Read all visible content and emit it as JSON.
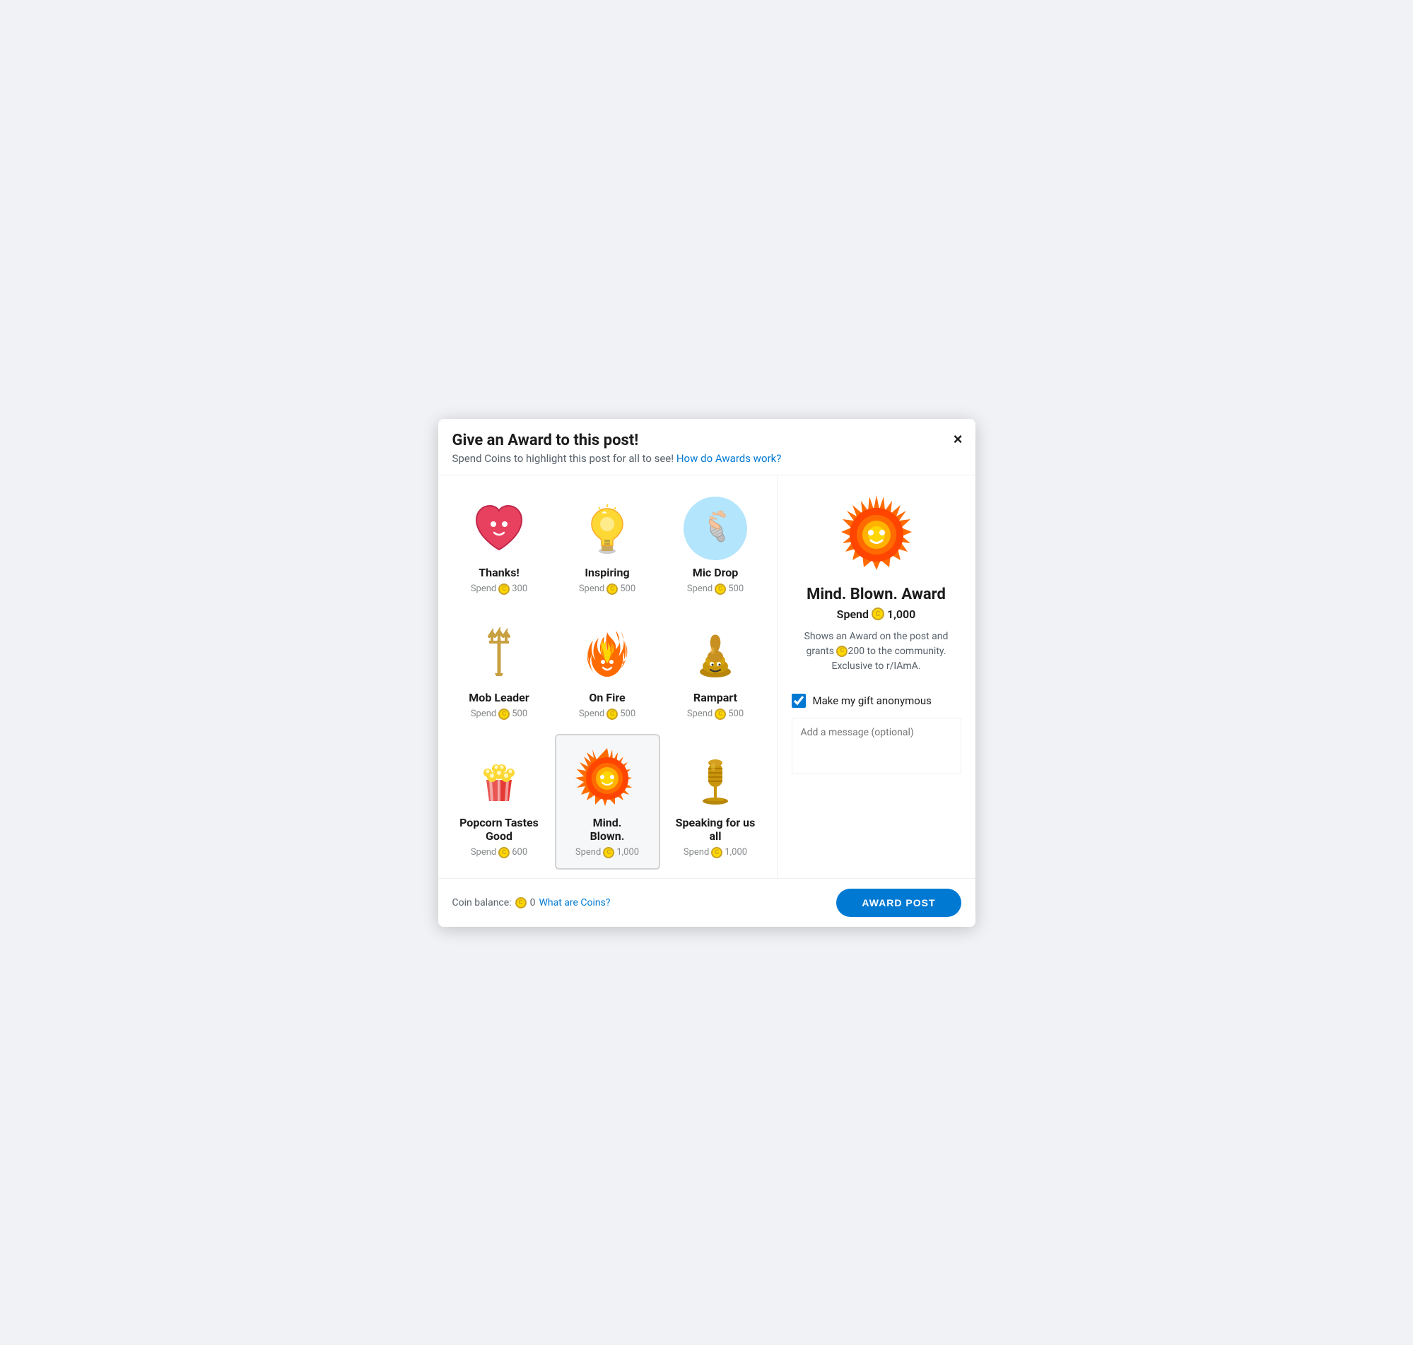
{
  "modal": {
    "title": "Give an Award to this post!",
    "subtitle": "Spend Coins to highlight this post for all to see!",
    "subtitle_link": "How do Awards work?",
    "close_label": "×"
  },
  "awards": [
    {
      "id": "thanks",
      "name": "Thanks!",
      "emoji": "❤️",
      "emoji_class": "emoji-heart",
      "cost": "300",
      "type": "emoji",
      "selected": false
    },
    {
      "id": "inspiring",
      "name": "Inspiring",
      "emoji": "💡",
      "emoji_class": "emoji-bulb",
      "cost": "500",
      "type": "emoji",
      "selected": false
    },
    {
      "id": "mic-drop",
      "name": "Mic Drop",
      "emoji": "🎤",
      "emoji_class": "",
      "cost": "500",
      "type": "mic-drop",
      "selected": false
    },
    {
      "id": "mob-leader",
      "name": "Mob Leader",
      "emoji": "🔱",
      "emoji_class": "emoji-trident",
      "cost": "500",
      "type": "emoji",
      "selected": false
    },
    {
      "id": "on-fire",
      "name": "On Fire",
      "emoji": "🔥",
      "emoji_class": "emoji-fire",
      "cost": "500",
      "type": "emoji",
      "selected": false
    },
    {
      "id": "rampart",
      "name": "Rampart",
      "emoji": "💩",
      "emoji_class": "emoji-poop",
      "cost": "500",
      "type": "emoji",
      "selected": false
    },
    {
      "id": "popcorn",
      "name": "Popcorn Tastes Good",
      "emoji": "🍿",
      "emoji_class": "emoji-popcorn",
      "cost": "600",
      "type": "emoji",
      "selected": false
    },
    {
      "id": "mind-blown",
      "name": "Mind.\nBlown.",
      "emoji": "💥",
      "emoji_class": "",
      "cost": "1,000",
      "type": "explosion",
      "selected": true
    },
    {
      "id": "speaking",
      "name": "Speaking for us all",
      "emoji": "🎙️",
      "emoji_class": "emoji-mic",
      "cost": "1,000",
      "type": "emoji",
      "selected": false
    }
  ],
  "featured": {
    "name": "Mind. Blown. Award",
    "cost": "1,000",
    "description": "Shows an Award on the post and grants 🪙200 to the community. Exclusive to r/IAmA."
  },
  "anonymous": {
    "label": "Make my gift anonymous",
    "checked": true
  },
  "message": {
    "placeholder": "Add a message (optional)"
  },
  "footer": {
    "coin_balance_label": "Coin balance:",
    "coin_amount": "0",
    "what_are_coins": "What are Coins?",
    "award_button": "AWARD POST"
  }
}
